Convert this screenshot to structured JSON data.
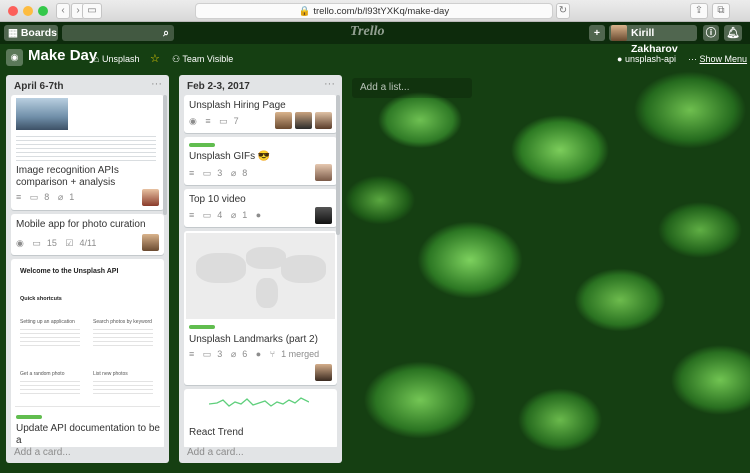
{
  "browser": {
    "url": "trello.com/b/l93tYXKq/make-day",
    "colors": {
      "close": "#fc605b",
      "minimize": "#fdbc40",
      "zoom": "#34c84a"
    }
  },
  "header": {
    "boards_label": "Boards",
    "logo": "Trello",
    "user_name": "Kirill Zakharov"
  },
  "board": {
    "title": "Make Day",
    "team": "Unsplash",
    "visibility": "Team Visible",
    "powerup": "unsplash-api",
    "show_menu": "Show Menu",
    "add_list": "Add a list..."
  },
  "lists": [
    {
      "title": "April 6-7th",
      "more": "···",
      "add_card": "Add a card...",
      "cards": [
        {
          "title": "Image recognition APIs comparison + analysis",
          "comments": "8",
          "attachments": "1"
        },
        {
          "title": "Mobile app for photo curation",
          "comments": "15",
          "checklist": "4/11"
        },
        {
          "title": "Update API documentation to be a",
          "doc": {
            "title": "Welcome to the Unsplash API",
            "subtitle": "Quick shortcuts",
            "items": [
              "Setting up an application",
              "Search photos by keyword",
              "Get a random photo",
              "List new photos"
            ]
          }
        }
      ]
    },
    {
      "title": "Feb 2-3, 2017",
      "more": "···",
      "add_card": "Add a card...",
      "cards": [
        {
          "title": "Unsplash Hiring Page",
          "comments": "7"
        },
        {
          "title": "Unsplash GIFs 😎",
          "comments": "3",
          "attachments": "8"
        },
        {
          "title": "Top 10 video",
          "comments": "4",
          "attachments": "1"
        },
        {
          "title": "Unsplash Landmarks (part 2)",
          "comments": "3",
          "attachments": "6",
          "merged": "1 merged"
        },
        {
          "title": "React Trend"
        }
      ]
    }
  ]
}
